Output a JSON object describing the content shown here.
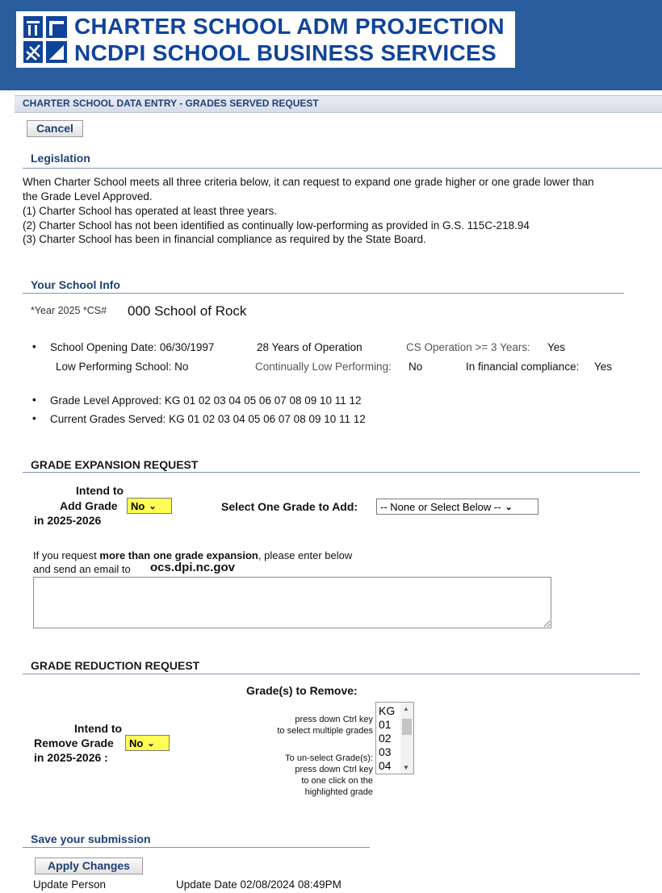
{
  "banner": {
    "line1": "CHARTER SCHOOL ADM PROJECTION",
    "line2": "NCDPI SCHOOL BUSINESS SERVICES",
    "logo_icon": "ncdpi-logo-icon"
  },
  "page": {
    "title": "CHARTER SCHOOL DATA ENTRY - GRADES SERVED REQUEST",
    "cancel_label": "Cancel"
  },
  "legislation": {
    "title": "Legislation",
    "line1": "When Charter School meets all three criteria below, it can request to expand one grade higher or one grade lower than",
    "line2": "the Grade Level Approved.",
    "c1": "(1) Charter School has operated at least three years.",
    "c2": "(2) Charter School has not been identified as continually low-performing as provided in G.S. 115C-218.94",
    "c3": "(3) Charter School has been in financial compliance as required by the State Board."
  },
  "school_info": {
    "title": "Your School Info",
    "year_label": "*Year 2025 *CS#",
    "school": "000 School of Rock",
    "opening": "School Opening Date: 06/30/1997",
    "years_op": "28 Years of Operation",
    "cs_op_label": "CS Operation >= 3 Years:",
    "cs_op_val": "Yes",
    "low_perf": "Low Performing School: No",
    "cont_low_label": "Continually Low Performing:",
    "cont_low_val": "No",
    "fin_label": "In financial compliance:",
    "fin_val": "Yes",
    "grade_approved": "Grade Level Approved:  KG 01 02 03 04 05 06 07 08 09 10 11 12",
    "current_grades": "Current Grades Served: KG 01 02 03 04 05 06 07 08 09 10 11 12"
  },
  "expansion": {
    "title": "GRADE EXPANSION REQUEST",
    "intend_l1": "Intend to",
    "intend_l2": "Add Grade",
    "intend_l3": "in 2025-2026",
    "intend_value": "No",
    "select_label": "Select One Grade to Add:",
    "select_value": "-- None or Select Below --",
    "note_prefix": "If you request ",
    "note_bold": "more than one grade expansion",
    "note_suffix": ", please enter below",
    "note2": "and send an email to",
    "email": "ocs.dpi.nc.gov",
    "textarea_value": ""
  },
  "reduction": {
    "title": "GRADE REDUCTION REQUEST",
    "remove_label": "Grade(s) to Remove:",
    "hint1a": "press down Ctrl key",
    "hint1b": "to select multiple grades",
    "hint2a": "To un-select Grade(s):",
    "hint2b": "press down Ctrl key",
    "hint2c": "to one click on the",
    "hint2d": "highlighted grade",
    "intend_l1": "Intend to",
    "intend_l2": "Remove Grade",
    "intend_l3": "in 2025-2026 :",
    "intend_value": "No",
    "grades": [
      "KG",
      "01",
      "02",
      "03",
      "04"
    ]
  },
  "save": {
    "title": "Save your submission",
    "apply_label": "Apply Changes",
    "update_person": "Update Person",
    "update_date": "Update Date 02/08/2024 08:49PM"
  }
}
